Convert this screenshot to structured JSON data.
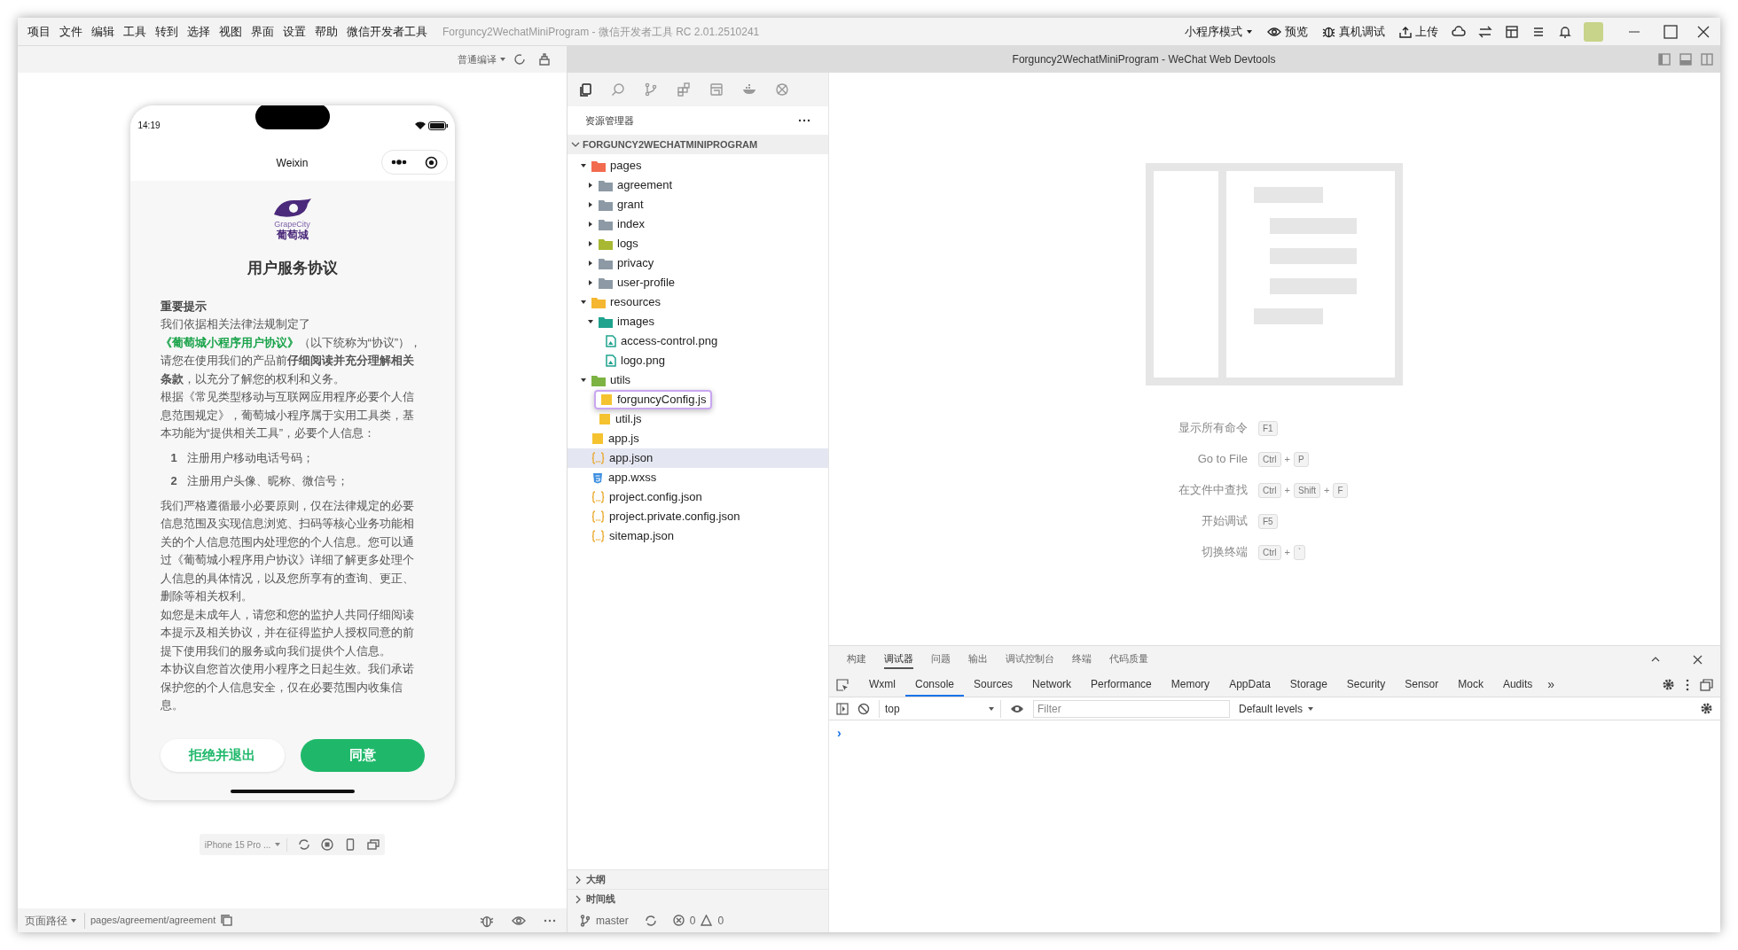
{
  "menu_bar": {
    "items": [
      "项目",
      "文件",
      "编辑",
      "工具",
      "转到",
      "选择",
      "视图",
      "界面",
      "设置",
      "帮助",
      "微信开发者工具"
    ],
    "title": "Forguncy2WechatMiniProgram - 微信开发者工具 RC 2.01.2510241",
    "toolbar": [
      {
        "kind": "dropdown",
        "label": "小程序模式"
      },
      {
        "kind": "eye",
        "label": "预览"
      },
      {
        "kind": "bug",
        "label": "真机调试"
      },
      {
        "kind": "upload",
        "label": "上传"
      }
    ]
  },
  "simulator": {
    "compile_mode": "普通编译",
    "phone": {
      "time": "14:19",
      "nav_title": "Weixin",
      "logo_text": "GrapeCity",
      "logo_name": "葡萄城",
      "title": "用户服务协议",
      "heading": "重要提示",
      "blocks": [
        {
          "kind": "paragraph",
          "parts": [
            {
              "kind": "text",
              "text": "我们依据相关法律法规制定了"
            },
            {
              "kind": "link",
              "text": "《葡萄城小程序用户协议》"
            },
            {
              "kind": "text",
              "text": "（以下统称为“协议”），请您在使用我们的产品前**仔细阅读并充分理解相关条款**，以充分了解您的权利和义务。"
            }
          ]
        },
        {
          "kind": "paragraph",
          "parts": [
            {
              "kind": "text",
              "text": "根据《常见类型移动与互联网应用程序必要个人信息范围规定》，葡萄城小程序属于实用工具类，基本功能为“提供相关工具”，必要个人信息："
            }
          ]
        },
        {
          "kind": "list",
          "items": [
            {
              "number": "1",
              "text": "注册用户移动电话号码；"
            },
            {
              "number": "2",
              "text": "注册用户头像、昵称、微信号；"
            }
          ]
        },
        {
          "kind": "paragraph",
          "parts": [
            {
              "kind": "text",
              "text": "我们严格遵循最小必要原则，仅在法律规定的必要信息范围及实现信息浏览、扫码等核心业务功能相关的个人信息范围内处理您的个人信息。您可以通过《葡萄城小程序用户协议》详细了解更多处理个人信息的具体情况，以及您所享有的查询、更正、删除等相关权利。"
            }
          ]
        },
        {
          "kind": "paragraph",
          "parts": [
            {
              "kind": "text",
              "text": "如您是未成年人，请您和您的监护人共同仔细阅读本提示及相关协议，并在征得监护人授权同意的前提下使用我们的服务或向我们提供个人信息。"
            }
          ]
        },
        {
          "kind": "paragraph",
          "parts": [
            {
              "kind": "text",
              "text": "本协议自您首次使用小程序之日起生效。我们承诺保护您的个人信息安全，仅在必要范围内收集信息。"
            }
          ]
        }
      ],
      "buttons": [
        {
          "kind": "secondary",
          "label": "拒绝并退出"
        },
        {
          "kind": "primary",
          "label": "同意"
        }
      ]
    },
    "device": "iPhone 15 Pro ...",
    "status_bar": {
      "path_label": "页面路径",
      "path": "pages/agreement/agreement"
    }
  },
  "window_title": "Forguncy2WechatMiniProgram - WeChat Web Devtools",
  "explorer": {
    "title": "资源管理器",
    "project": "FORGUNCY2WECHATMINIPROGRAM",
    "tree": [
      {
        "label": "pages",
        "kind": "folder",
        "color": "#f26b4f",
        "expanded": true,
        "selected": false,
        "children": [
          {
            "label": "agreement",
            "kind": "folder",
            "color": "#8d9aa5",
            "expanded": false,
            "selected": false
          },
          {
            "label": "grant",
            "kind": "folder",
            "color": "#8d9aa5",
            "expanded": false,
            "selected": false
          },
          {
            "label": "index",
            "kind": "folder",
            "color": "#8d9aa5",
            "expanded": false,
            "selected": false
          },
          {
            "label": "logs",
            "kind": "folder",
            "color": "#a8b832",
            "expanded": false,
            "selected": false
          },
          {
            "label": "privacy",
            "kind": "folder",
            "color": "#8d9aa5",
            "expanded": false,
            "selected": false
          },
          {
            "label": "user-profile",
            "kind": "folder",
            "color": "#8d9aa5",
            "expanded": false,
            "selected": false
          }
        ]
      },
      {
        "label": "resources",
        "kind": "folder",
        "color": "#f5b731",
        "expanded": true,
        "selected": false,
        "children": [
          {
            "label": "images",
            "kind": "folder",
            "color": "#1fa38e",
            "expanded": true,
            "selected": false,
            "children": [
              {
                "label": "access-control.png",
                "kind": "image",
                "selected": false
              },
              {
                "label": "logo.png",
                "kind": "image",
                "selected": false
              }
            ]
          }
        ]
      },
      {
        "label": "utils",
        "kind": "folder",
        "color": "#7cb342",
        "expanded": true,
        "selected": false,
        "children": [
          {
            "label": "forguncyConfig.js",
            "kind": "js",
            "selected": false,
            "highlighted": true
          },
          {
            "label": "util.js",
            "kind": "js",
            "selected": false
          }
        ]
      },
      {
        "label": "app.js",
        "kind": "js",
        "selected": false
      },
      {
        "label": "app.json",
        "kind": "json",
        "selected": true
      },
      {
        "label": "app.wxss",
        "kind": "css",
        "selected": false
      },
      {
        "label": "project.config.json",
        "kind": "json",
        "selected": false
      },
      {
        "label": "project.private.config.json",
        "kind": "json",
        "selected": false
      },
      {
        "label": "sitemap.json",
        "kind": "json",
        "selected": false
      }
    ],
    "sections": [
      "大纲",
      "时间线"
    ],
    "status": {
      "branch": "master",
      "errors": "0",
      "warnings": "0"
    }
  },
  "editor": {
    "joiner": "+",
    "shortcuts": [
      {
        "label": "显示所有命令",
        "keys": [
          "F1"
        ]
      },
      {
        "label": "Go to File",
        "keys": [
          "Ctrl",
          "P"
        ]
      },
      {
        "label": "在文件中查找",
        "keys": [
          "Ctrl",
          "Shift",
          "F"
        ]
      },
      {
        "label": "开始调试",
        "keys": [
          "F5"
        ]
      },
      {
        "label": "切换终端",
        "keys": [
          "Ctrl",
          "`"
        ]
      }
    ]
  },
  "panel": {
    "tabs": [
      {
        "label": "构建",
        "selected": false
      },
      {
        "label": "调试器",
        "selected": true
      },
      {
        "label": "问题",
        "selected": false
      },
      {
        "label": "输出",
        "selected": false
      },
      {
        "label": "调试控制台",
        "selected": false
      },
      {
        "label": "终端",
        "selected": false
      },
      {
        "label": "代码质量",
        "selected": false
      }
    ],
    "devtools_tabs": [
      {
        "label": "Wxml",
        "selected": false
      },
      {
        "label": "Console",
        "selected": true
      },
      {
        "label": "Sources",
        "selected": false
      },
      {
        "label": "Network",
        "selected": false
      },
      {
        "label": "Performance",
        "selected": false
      },
      {
        "label": "Memory",
        "selected": false
      },
      {
        "label": "AppData",
        "selected": false
      },
      {
        "label": "Storage",
        "selected": false
      },
      {
        "label": "Security",
        "selected": false
      },
      {
        "label": "Sensor",
        "selected": false
      },
      {
        "label": "Mock",
        "selected": false
      },
      {
        "label": "Audits",
        "selected": false
      }
    ],
    "more": "»",
    "context": "top",
    "filter_placeholder": "Filter",
    "levels": "Default levels",
    "prompt": "›"
  }
}
